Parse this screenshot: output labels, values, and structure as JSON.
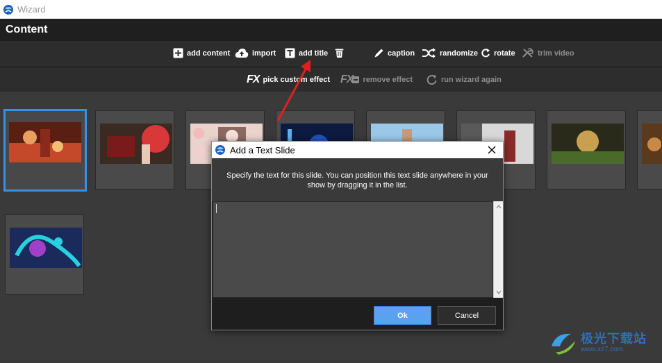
{
  "window": {
    "title": "Wizard",
    "logo_icon": "globe-logo-icon"
  },
  "header": {
    "title": "Content"
  },
  "toolbar_top": {
    "items": [
      {
        "label": "add content",
        "icon": "plus-square-icon",
        "enabled": true
      },
      {
        "label": "import",
        "icon": "cloud-upload-icon",
        "enabled": true
      },
      {
        "label": "add title",
        "icon": "text-t-icon",
        "enabled": true
      },
      {
        "label": "",
        "icon": "trash-icon",
        "enabled": true
      },
      {
        "label": "caption",
        "icon": "pencil-icon",
        "enabled": true
      },
      {
        "label": "randomize",
        "icon": "shuffle-icon",
        "enabled": true
      },
      {
        "label": "rotate",
        "icon": "rotate-icon",
        "enabled": true
      },
      {
        "label": "trim video",
        "icon": "tools-icon",
        "enabled": false
      }
    ]
  },
  "toolbar_effects": {
    "items": [
      {
        "label": "pick custom effect",
        "icon": "fx-icon",
        "enabled": true
      },
      {
        "label": "remove effect",
        "icon": "fx-remove-icon",
        "enabled": false
      },
      {
        "label": "run wizard again",
        "icon": "refresh-icon",
        "enabled": false
      }
    ]
  },
  "thumbnails": [
    {
      "name": "thumb-1",
      "selected": true,
      "colors": [
        "#5a1e12",
        "#c4482a",
        "#e8a060"
      ]
    },
    {
      "name": "thumb-2",
      "selected": false,
      "colors": [
        "#7a1a1a",
        "#d93838",
        "#3b2a22"
      ]
    },
    {
      "name": "thumb-3",
      "selected": false,
      "colors": [
        "#e9d3cc",
        "#f3bcbc",
        "#8a6a60"
      ]
    },
    {
      "name": "thumb-4",
      "selected": false,
      "colors": [
        "#0c1a40",
        "#2356a8",
        "#60b0e8"
      ]
    },
    {
      "name": "thumb-5",
      "selected": false,
      "colors": [
        "#9ac8e8",
        "#e8d8c8",
        "#c89a7a"
      ]
    },
    {
      "name": "thumb-6",
      "selected": false,
      "colors": [
        "#d8d8d8",
        "#8a2a2a",
        "#5a5a5a"
      ]
    },
    {
      "name": "thumb-7",
      "selected": false,
      "colors": [
        "#2a2a1a",
        "#c8a050",
        "#4a6a2a"
      ]
    },
    {
      "name": "thumb-8",
      "selected": false,
      "colors": [
        "#5a3a1a",
        "#c88a4a",
        "#2a1a10"
      ]
    },
    {
      "name": "thumb-9",
      "selected": false,
      "colors": [
        "#1a2a5a",
        "#28d0e0",
        "#a040c8"
      ]
    }
  ],
  "dialog": {
    "title": "Add a Text Slide",
    "message": "Specify the text for this slide. You can position this text slide anywhere in your show by dragging it in the list.",
    "text_value": "",
    "ok_label": "Ok",
    "cancel_label": "Cancel"
  },
  "watermark": {
    "line1": "极光下载站",
    "line2": "www.xz7.com"
  },
  "colors": {
    "accent": "#3c8fe6",
    "ok_button": "#5aa1f0",
    "annotation_arrow": "#e02020"
  }
}
